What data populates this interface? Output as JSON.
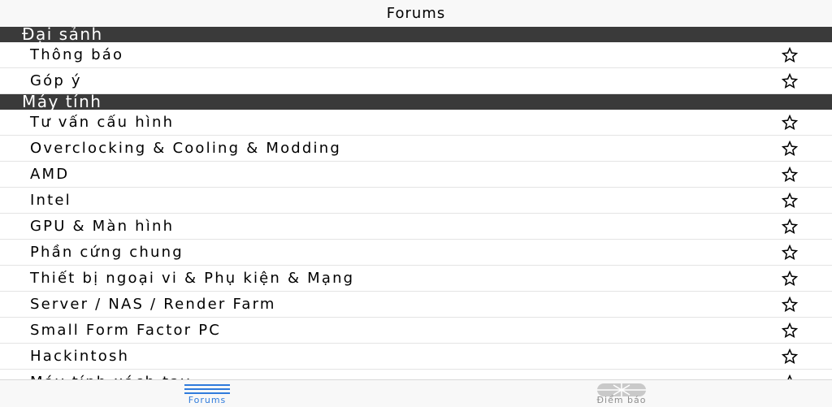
{
  "nav": {
    "title": "Forums"
  },
  "sections": [
    {
      "header": "Đại sảnh",
      "items": [
        {
          "label": "Thông báo",
          "icon": "star-outline-icon"
        },
        {
          "label": "Góp ý",
          "icon": "star-outline-icon"
        }
      ]
    },
    {
      "header": "Máy tính",
      "items": [
        {
          "label": "Tư vấn cấu hình",
          "icon": "star-outline-icon"
        },
        {
          "label": "Overclocking & Cooling & Modding",
          "icon": "star-outline-icon"
        },
        {
          "label": "AMD",
          "icon": "star-outline-icon"
        },
        {
          "label": "Intel",
          "icon": "star-outline-icon"
        },
        {
          "label": "GPU & Màn hình",
          "icon": "star-outline-icon"
        },
        {
          "label": "Phần cứng chung",
          "icon": "star-outline-icon"
        },
        {
          "label": "Thiết bị ngoại vi & Phụ kiện & Mạng",
          "icon": "star-outline-icon"
        },
        {
          "label": "Server / NAS / Render Farm",
          "icon": "star-outline-icon"
        },
        {
          "label": "Small Form Factor PC",
          "icon": "star-outline-icon"
        },
        {
          "label": "Hackintosh",
          "icon": "star-outline-icon"
        },
        {
          "label": "Máy tính xách tay",
          "icon": "star-outline-icon"
        }
      ]
    }
  ],
  "tabs": [
    {
      "label": "Forums",
      "icon": "list-lines-icon",
      "active": true,
      "color": "#2f7bdc"
    },
    {
      "label": "Điểm báo",
      "icon": "newspaper-icon",
      "active": false,
      "color": "#8e8e8e"
    }
  ]
}
